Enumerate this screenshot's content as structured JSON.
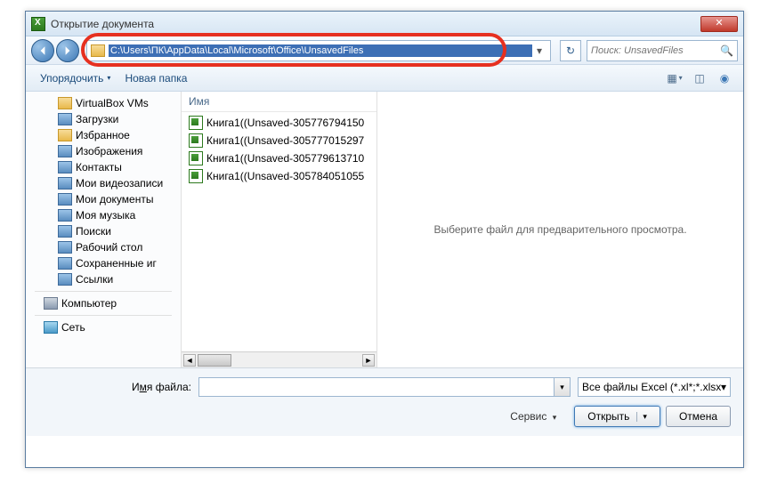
{
  "window": {
    "title": "Открытие документа",
    "close": "✕"
  },
  "nav": {
    "address_path": "C:\\Users\\ПК\\AppData\\Local\\Microsoft\\Office\\UnsavedFiles",
    "address_drop": "▾",
    "refresh": "↻",
    "search_placeholder": "Поиск: UnsavedFiles"
  },
  "toolbar": {
    "organize": "Упорядочить",
    "new_folder": "Новая папка",
    "drop": "▾"
  },
  "tree": {
    "items": [
      {
        "label": "VirtualBox VMs",
        "cls": "folder-icon",
        "lvl": "l2"
      },
      {
        "label": "Загрузки",
        "cls": "folder-blue",
        "lvl": "l2"
      },
      {
        "label": "Избранное",
        "cls": "folder-icon",
        "lvl": "l2"
      },
      {
        "label": "Изображения",
        "cls": "folder-blue",
        "lvl": "l2"
      },
      {
        "label": "Контакты",
        "cls": "folder-blue",
        "lvl": "l2"
      },
      {
        "label": "Мои видеозаписи",
        "cls": "folder-blue",
        "lvl": "l2"
      },
      {
        "label": "Мои документы",
        "cls": "folder-blue",
        "lvl": "l2"
      },
      {
        "label": "Моя музыка",
        "cls": "folder-blue",
        "lvl": "l2"
      },
      {
        "label": "Поиски",
        "cls": "folder-blue",
        "lvl": "l2"
      },
      {
        "label": "Рабочий стол",
        "cls": "folder-blue",
        "lvl": "l2"
      },
      {
        "label": "Сохраненные иг",
        "cls": "folder-blue",
        "lvl": "l2"
      },
      {
        "label": "Ссылки",
        "cls": "folder-blue",
        "lvl": "l2"
      }
    ],
    "computer": "Компьютер",
    "network": "Сеть"
  },
  "filelist": {
    "header": "Имя",
    "files": [
      "Книга1((Unsaved-305776794150",
      "Книга1((Unsaved-305777015297",
      "Книга1((Unsaved-305779613710",
      "Книга1((Unsaved-305784051055"
    ],
    "scroll_left": "◄",
    "scroll_right": "►"
  },
  "preview": {
    "text": "Выберите файл для предварительного просмотра."
  },
  "bottom": {
    "filename_label_pre": "И",
    "filename_label_ul": "м",
    "filename_label_post": "я файла:",
    "filter": "Все файлы Excel (*.xl*;*.xlsx;*.xl",
    "filter_drop": "▾",
    "tools": "Сервис",
    "tools_drop": "▾",
    "open": "Открыть",
    "open_drop": "▾",
    "cancel": "Отмена",
    "input_drop": "▾"
  }
}
